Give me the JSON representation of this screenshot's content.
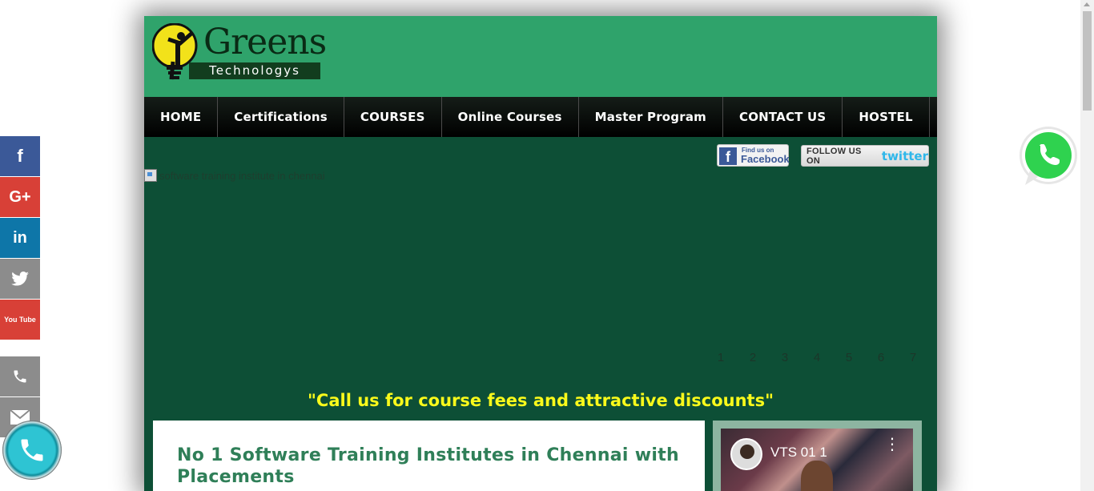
{
  "brand": {
    "name": "Greens",
    "tagline": "Technologys"
  },
  "nav": [
    {
      "label": "HOME"
    },
    {
      "label": "Certifications"
    },
    {
      "label": "COURSES"
    },
    {
      "label": "Online Courses"
    },
    {
      "label": "Master Program"
    },
    {
      "label": "CONTACT US"
    },
    {
      "label": "HOSTEL"
    }
  ],
  "social_badges": {
    "facebook_small": "Find us on",
    "facebook_big": "Facebook",
    "twitter_prefix": "FOLLOW US ON",
    "twitter_logo": "twitter"
  },
  "hero": {
    "alt_text": "software training institute in chennai"
  },
  "slider_pages": [
    "1",
    "2",
    "3",
    "4",
    "5",
    "6",
    "7"
  ],
  "cta": "\"Call us for course fees and attractive discounts\"",
  "main": {
    "heading": "No 1 Software Training Institutes in Chennai with Placements"
  },
  "video": {
    "title": "VTS 01 1"
  },
  "sidebar_icons": [
    "facebook-icon",
    "google-plus-icon",
    "linkedin-icon",
    "twitter-icon",
    "youtube-icon",
    "phone-icon",
    "mail-icon"
  ],
  "sidebar_labels": {
    "facebook": "f",
    "google_plus": "G+",
    "linkedin": "in",
    "youtube": "You Tube"
  },
  "colors": {
    "header_green": "#2fa36b",
    "page_dark_green": "#0d4f36",
    "cta_yellow": "#f9f91b",
    "heading_green": "#2f7f58"
  }
}
